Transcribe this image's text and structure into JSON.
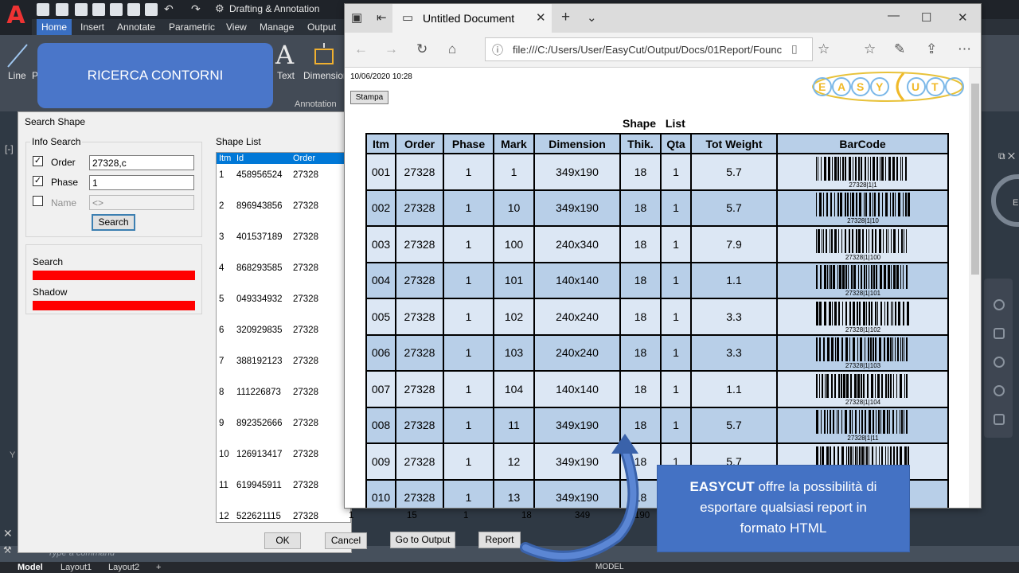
{
  "acad": {
    "logo": "A",
    "workspace": "Drafting & Annotation",
    "ribbon_tabs": [
      "Home",
      "Insert",
      "Annotate",
      "Parametric",
      "View",
      "Manage",
      "Output"
    ],
    "tools": {
      "line": "Line",
      "p": "P",
      "text": "Text",
      "dimension": "Dimension"
    },
    "panel_label": "Annotation",
    "command_placeholder": "Type a command",
    "layout_tabs": [
      "Model",
      "Layout1",
      "Layout2"
    ],
    "status_model": "MODEL"
  },
  "callout_top": "RICERCA CONTORNI",
  "dialog": {
    "title": "Search Shape",
    "info_search_label": "Info Search",
    "order_label": "Order",
    "order_value": "27328,c",
    "order_checked": "✓",
    "phase_label": "Phase",
    "phase_value": "1",
    "phase_checked": "✓",
    "name_label": "Name",
    "name_value": "<>",
    "search_button": "Search",
    "search_bar_label": "Search",
    "shadow_bar_label": "Shadow",
    "shape_list_label": "Shape List",
    "columns": [
      "Itm",
      "Id",
      "Order"
    ],
    "rows": [
      [
        "1",
        "458956524",
        "27328"
      ],
      [
        "2",
        "896943856",
        "27328"
      ],
      [
        "3",
        "401537189",
        "27328"
      ],
      [
        "4",
        "868293585",
        "27328"
      ],
      [
        "5",
        "049334932",
        "27328"
      ],
      [
        "6",
        "320929835",
        "27328"
      ],
      [
        "7",
        "388192123",
        "27328"
      ],
      [
        "8",
        "111226873",
        "27328"
      ],
      [
        "9",
        "892352666",
        "27328"
      ],
      [
        "10",
        "126913417",
        "27328"
      ],
      [
        "11",
        "619945911",
        "27328"
      ],
      [
        "12",
        "522621115",
        "27328"
      ]
    ],
    "row12_extra": [
      "1",
      "15",
      "1",
      "18",
      "349",
      "190"
    ],
    "buttons": {
      "ok": "OK",
      "cancel": "Cancel",
      "go_to_output": "Go to Output",
      "report": "Report"
    }
  },
  "browser": {
    "tab_title": "Untitled Document",
    "address": "file:///C:/Users/User/EasyCut/Output/Docs/01Report/Founc",
    "page": {
      "date": "10/06/2020 10:28",
      "stampa": "Stampa",
      "logo": "EASYCUT",
      "title": "Shape List",
      "columns": [
        "Itm",
        "Order",
        "Phase",
        "Mark",
        "Dimension",
        "Thik.",
        "Qta",
        "Tot Weight",
        "BarCode"
      ],
      "rows": [
        {
          "itm": "001",
          "order": "27328",
          "phase": "1",
          "mark": "1",
          "dimension": "349x190",
          "thik": "18",
          "qta": "1",
          "weight": "5.7",
          "barcode": "27328|1|1"
        },
        {
          "itm": "002",
          "order": "27328",
          "phase": "1",
          "mark": "10",
          "dimension": "349x190",
          "thik": "18",
          "qta": "1",
          "weight": "5.7",
          "barcode": "27328|1|10"
        },
        {
          "itm": "003",
          "order": "27328",
          "phase": "1",
          "mark": "100",
          "dimension": "240x340",
          "thik": "18",
          "qta": "1",
          "weight": "7.9",
          "barcode": "27328|1|100"
        },
        {
          "itm": "004",
          "order": "27328",
          "phase": "1",
          "mark": "101",
          "dimension": "140x140",
          "thik": "18",
          "qta": "1",
          "weight": "1.1",
          "barcode": "27328|1|101"
        },
        {
          "itm": "005",
          "order": "27328",
          "phase": "1",
          "mark": "102",
          "dimension": "240x240",
          "thik": "18",
          "qta": "1",
          "weight": "3.3",
          "barcode": "27328|1|102"
        },
        {
          "itm": "006",
          "order": "27328",
          "phase": "1",
          "mark": "103",
          "dimension": "240x240",
          "thik": "18",
          "qta": "1",
          "weight": "3.3",
          "barcode": "27328|1|103"
        },
        {
          "itm": "007",
          "order": "27328",
          "phase": "1",
          "mark": "104",
          "dimension": "140x140",
          "thik": "18",
          "qta": "1",
          "weight": "1.1",
          "barcode": "27328|1|104"
        },
        {
          "itm": "008",
          "order": "27328",
          "phase": "1",
          "mark": "11",
          "dimension": "349x190",
          "thik": "18",
          "qta": "1",
          "weight": "5.7",
          "barcode": "27328|1|11"
        },
        {
          "itm": "009",
          "order": "27328",
          "phase": "1",
          "mark": "12",
          "dimension": "349x190",
          "thik": "18",
          "qta": "1",
          "weight": "5.7",
          "barcode": ""
        },
        {
          "itm": "010",
          "order": "27328",
          "phase": "1",
          "mark": "13",
          "dimension": "349x190",
          "thik": "18",
          "qta": "1",
          "weight": "",
          "barcode": ""
        }
      ]
    }
  },
  "callout_bottom": {
    "brand": "EASYCUT",
    "line1": " offre la possibilità di",
    "line2": "esportare qualsiasi report in",
    "line3": "formato HTML"
  },
  "colors": {
    "callout_blue": "#4a76c9",
    "header_blue": "#b8cfe8",
    "row_light": "#dce7f4",
    "status_red": "#ff0000",
    "selection_blue": "#0078d7"
  }
}
